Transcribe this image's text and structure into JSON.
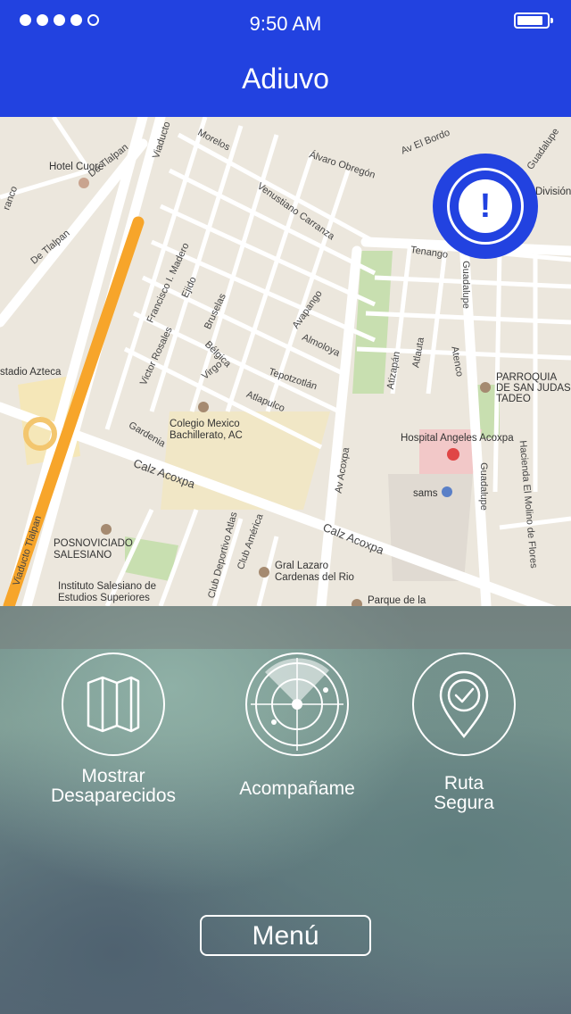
{
  "status_bar": {
    "time": "9:50 AM",
    "signal_dots_filled": 4,
    "signal_dots_total": 5,
    "battery_icon": "battery-icon"
  },
  "header": {
    "title": "Adiuvo",
    "background": "#2242e0"
  },
  "map": {
    "labels": {
      "hotel_cuore": "Hotel Cuore",
      "de_tlalpan_1": "De Tlalpan",
      "de_tlalpan_2": "De Tlalpan",
      "viaducto": "Viaducto",
      "morelos": "Morelos",
      "alvaro_obregon": "Álvaro Obregón",
      "av_el_bordo": "Av El Bordo",
      "guadalupe_top": "Guadalupe",
      "venustiano": "Venustiano Carranza",
      "division": "División N",
      "tenango": "Tenango",
      "guadalupe_mid": "Guadalupe",
      "francisco": "Francisco I. Madero",
      "ejido": "Ejido",
      "bruselas": "Bruselas",
      "avapango": "Avapango",
      "almoloya": "Almoloya",
      "atizapan": "Atizapán",
      "atlauta": "Atlauta",
      "atenco": "Atenco",
      "parroquia": "PARROQUIA DE SAN JUDAS TADEO",
      "estadio": "stadio Azteca",
      "victor": "Victor Rosales",
      "belgica": "Bélgica",
      "virgo": "Virgo",
      "tepotzotlan": "Tepotzotlán",
      "atlapulco": "Atlapulco",
      "colegio": "Colegio Mexico Bachillerato, AC",
      "gardenia": "Gardenia",
      "hospital": "Hospital Angeles Acoxpa",
      "calz_acoxpa_1": "Calz Acoxpa",
      "av_acoxpa": "Av Acoxpa",
      "sams": "sams",
      "guadalupe_low": "Guadalupe",
      "hacienda": "Hacienda El Molino de Flores",
      "calz_acoxpa_2": "Calz Acoxpa",
      "posnoviciado": "POSNOVICIADO SALESIANO",
      "viaducto_tlalpan": "Viaducto Tlalpan",
      "club_deportivo": "Club Deportivo Atlas",
      "club_america": "Club América",
      "gral_lazaro": "Gral Lazaro Cardenas del Rio",
      "instituto": "Instituto Salesiano de Estudios Superiores",
      "parque": "Parque de la",
      "tlalpan_franco": "ranco"
    },
    "alert_button": {
      "icon": "exclamation-icon",
      "glyph": "!"
    }
  },
  "actions": [
    {
      "label_line1": "Mostrar",
      "label_line2": "Desaparecidos",
      "icon": "map-icon"
    },
    {
      "label_line1": "Acompañame",
      "label_line2": "",
      "icon": "radar-icon"
    },
    {
      "label_line1": "Ruta",
      "label_line2": "Segura",
      "icon": "location-check-icon"
    }
  ],
  "menu_button": {
    "label": "Menú"
  }
}
